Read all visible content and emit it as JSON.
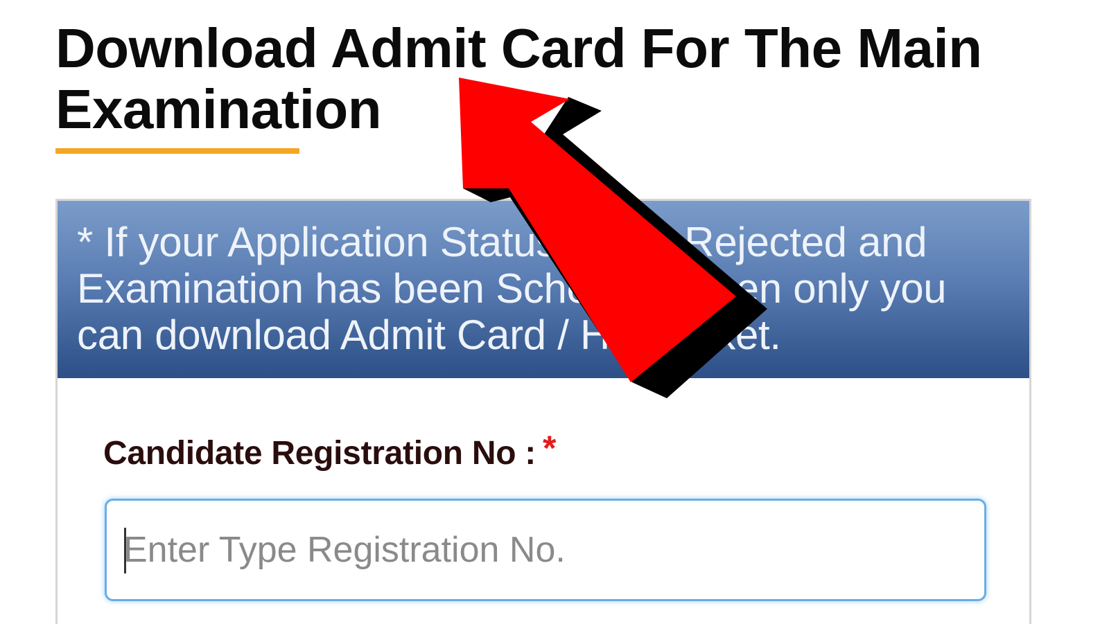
{
  "page": {
    "title": "Download Admit Card For The Main Examination"
  },
  "notice": {
    "text": "* If your Application Status is Not Rejected and Examination has been Scheduled then only you can download Admit Card / Hall Ticket."
  },
  "form": {
    "registration_label": "Candidate Registration No :",
    "required_marker": "*",
    "registration_placeholder": "Enter Type Registration No.",
    "registration_value": ""
  },
  "colors": {
    "title_underline": "#f5a623",
    "notice_banner_top": "#7b9cc9",
    "notice_banner_bottom": "#2b4f86",
    "required_marker": "#e51b1b",
    "input_focus_border": "#66aee8",
    "annotation_arrow": "#ff0000"
  },
  "overlay": {
    "annotation": "red-arrow-icon"
  }
}
